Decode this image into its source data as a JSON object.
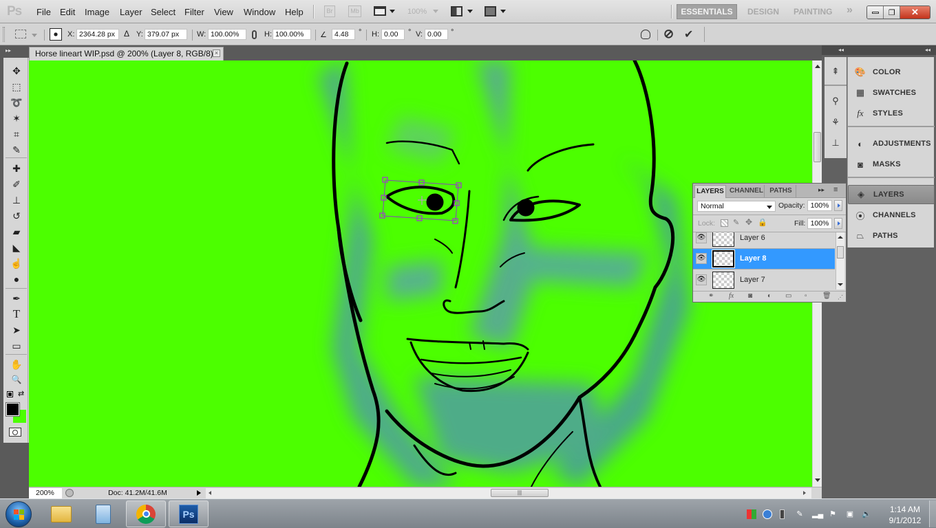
{
  "app": {
    "logo": "Ps",
    "menu": [
      "File",
      "Edit",
      "Image",
      "Layer",
      "Select",
      "Filter",
      "View",
      "Window",
      "Help"
    ],
    "appbar": {
      "bridge_label": "Br",
      "minibridge_label": "Mb",
      "zoom_level": "100%"
    },
    "workspaces": [
      "ESSENTIALS",
      "DESIGN",
      "PAINTING"
    ],
    "workspace_more": "»",
    "window_controls": {
      "minimize": "–",
      "restore": "❐",
      "close": "✕"
    }
  },
  "options_bar": {
    "x_label": "X:",
    "x_value": "2364.28 px",
    "delta_label": "Δ",
    "y_label": "Y:",
    "y_value": "379.07 px",
    "w_label": "W:",
    "w_value": "100.00%",
    "h_label": "H:",
    "h_value": "100.00%",
    "angle_value": "4.48",
    "skew_h_label": "H:",
    "skew_h_value": "0.00",
    "skew_v_label": "V:",
    "skew_v_value": "0.00",
    "degree": "°",
    "cancel_icon": "⊘",
    "commit_icon": "✔"
  },
  "document": {
    "tab_title": "Horse lineart WIP.psd @ 200% (Layer 8, RGB/8) *",
    "canvas_color": "#4cff00",
    "status": {
      "zoom": "200%",
      "doc_info": "Doc: 41.2M/41.6M"
    }
  },
  "tools": [
    {
      "name": "move-tool",
      "glyph": "✥"
    },
    {
      "name": "marquee-tool",
      "glyph": "⬚"
    },
    {
      "name": "lasso-tool",
      "glyph": "➰"
    },
    {
      "name": "magic-wand-tool",
      "glyph": "✶"
    },
    {
      "name": "crop-tool",
      "glyph": "⌗"
    },
    {
      "name": "eyedropper-tool",
      "glyph": "✎"
    },
    {
      "name": "healing-brush-tool",
      "glyph": "✚"
    },
    {
      "name": "brush-tool",
      "glyph": "✐"
    },
    {
      "name": "clone-stamp-tool",
      "glyph": "⊥"
    },
    {
      "name": "history-brush-tool",
      "glyph": "↺"
    },
    {
      "name": "eraser-tool",
      "glyph": "▰"
    },
    {
      "name": "paint-bucket-tool",
      "glyph": "◣"
    },
    {
      "name": "smudge-tool",
      "glyph": "☝"
    },
    {
      "name": "dodge-tool",
      "glyph": "●"
    },
    {
      "name": "pen-tool",
      "glyph": "✒"
    },
    {
      "name": "type-tool",
      "glyph": "T"
    },
    {
      "name": "path-selection-tool",
      "glyph": "➤"
    },
    {
      "name": "rectangle-tool",
      "glyph": "▭"
    },
    {
      "name": "hand-tool",
      "glyph": "✋"
    },
    {
      "name": "zoom-tool",
      "glyph": "🔍"
    }
  ],
  "colors": {
    "foreground": "#000000",
    "background": "#4cff00"
  },
  "dock": {
    "panels": [
      {
        "label": "COLOR",
        "icon": "palette-icon"
      },
      {
        "label": "SWATCHES",
        "icon": "swatches-icon"
      },
      {
        "label": "STYLES",
        "icon": "styles-icon"
      },
      {
        "label": "ADJUSTMENTS",
        "icon": "adjustments-icon"
      },
      {
        "label": "MASKS",
        "icon": "masks-icon"
      },
      {
        "label": "LAYERS",
        "icon": "layers-icon"
      },
      {
        "label": "CHANNELS",
        "icon": "channels-icon"
      },
      {
        "label": "PATHS",
        "icon": "paths-icon"
      }
    ]
  },
  "layers_panel": {
    "tabs": [
      "LAYERS",
      "CHANNEL",
      "PATHS"
    ],
    "blend_mode": "Normal",
    "opacity_label": "Opacity:",
    "opacity_value": "100%",
    "lock_label": "Lock:",
    "fill_label": "Fill:",
    "fill_value": "100%",
    "layers": [
      {
        "name": "Layer 6",
        "visible": true,
        "selected": false
      },
      {
        "name": "Layer 8",
        "visible": true,
        "selected": true
      },
      {
        "name": "Layer 7",
        "visible": true,
        "selected": false
      }
    ]
  },
  "taskbar": {
    "apps": [
      "Windows Explorer",
      "Calculator",
      "Google Chrome",
      "Adobe Photoshop"
    ],
    "ps_label": "Ps",
    "clock_time": "1:14 AM",
    "clock_date": "9/1/2012"
  }
}
